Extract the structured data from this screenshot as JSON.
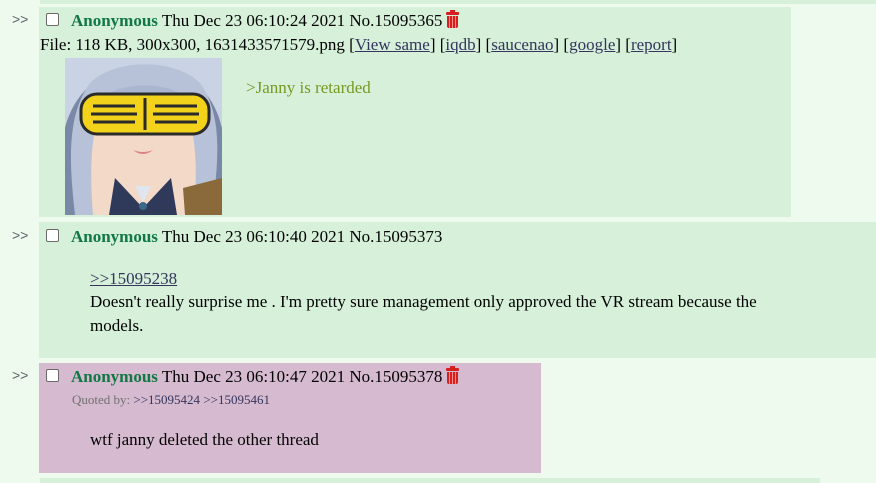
{
  "marker": ">>",
  "posts": [
    {
      "name": "Anonymous",
      "datetime": "Thu Dec 23 06:10:24 2021",
      "no_label": "No.",
      "no": "15095365",
      "file_label": "File: 118 KB, 300x300, 1631433571579.png",
      "file_links": [
        "View same",
        "iqdb",
        "saucenao",
        "google",
        "report"
      ],
      "greentext": ">Janny is retarded"
    },
    {
      "name": "Anonymous",
      "datetime": "Thu Dec 23 06:10:40 2021",
      "no_label": "No.",
      "no": "15095373",
      "quote": ">>15095238",
      "line1": "Doesn't really surprise me . I'm pretty sure management only approved the VR stream because the",
      "line2": "models."
    },
    {
      "name": "Anonymous",
      "datetime": "Thu Dec 23 06:10:47 2021",
      "no_label": "No.",
      "no": "15095378",
      "quoted_by_label": "Quoted by:",
      "quoted_by": [
        ">>15095424",
        ">>15095461"
      ],
      "message": "wtf janny deleted the other thread"
    }
  ],
  "colors": {
    "background": "#eefaee",
    "reply": "#d6f0da",
    "highlight": "#d6bad0",
    "name": "#117743",
    "greentext": "#789922",
    "link": "#34345c",
    "trash": "#d61f1f"
  },
  "icons": [
    "trash-icon",
    "checkbox"
  ]
}
